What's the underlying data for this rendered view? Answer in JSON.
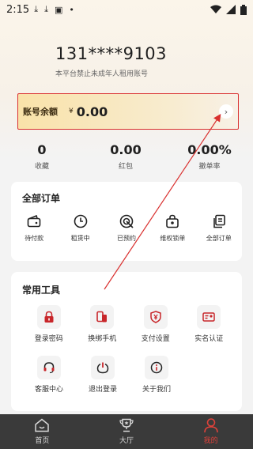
{
  "status_bar": {
    "time": "2:15"
  },
  "profile": {
    "phone": "131****9103",
    "notice": "本平台禁止未成年人租用账号"
  },
  "balance": {
    "label": "账号余额",
    "currency": "¥",
    "value": "0.00"
  },
  "stats": [
    {
      "value": "0",
      "label": "收藏"
    },
    {
      "value": "0.00",
      "label": "红包"
    },
    {
      "value": "0.00%",
      "label": "撤单率"
    }
  ],
  "orders": {
    "title": "全部订单",
    "items": [
      {
        "label": "待付款",
        "icon": "wallet-icon"
      },
      {
        "label": "租赁中",
        "icon": "clock-icon"
      },
      {
        "label": "已预约",
        "icon": "target-icon"
      },
      {
        "label": "维权锁单",
        "icon": "lock-bag-icon"
      },
      {
        "label": "全部订单",
        "icon": "document-copy-icon"
      }
    ]
  },
  "tools": {
    "title": "常用工具",
    "items": [
      {
        "label": "登录密码",
        "icon": "lock-icon"
      },
      {
        "label": "换绑手机",
        "icon": "phone-swap-icon"
      },
      {
        "label": "支付设置",
        "icon": "shield-yen-icon"
      },
      {
        "label": "实名认证",
        "icon": "id-card-icon"
      },
      {
        "label": "客服中心",
        "icon": "headset-icon"
      },
      {
        "label": "退出登录",
        "icon": "power-icon"
      },
      {
        "label": "关于我们",
        "icon": "info-icon"
      }
    ]
  },
  "tab_bar": {
    "items": [
      {
        "label": "首页",
        "icon": "home-icon",
        "active": false
      },
      {
        "label": "大厅",
        "icon": "trophy-icon",
        "active": false
      },
      {
        "label": "我的",
        "icon": "user-icon",
        "active": true
      }
    ]
  },
  "colors": {
    "accent_red": "#d9302f",
    "tool_icon_red": "#c8262a",
    "tab_bar_bg": "#3a3a3a",
    "balance_gold": "#f9e2a9"
  }
}
